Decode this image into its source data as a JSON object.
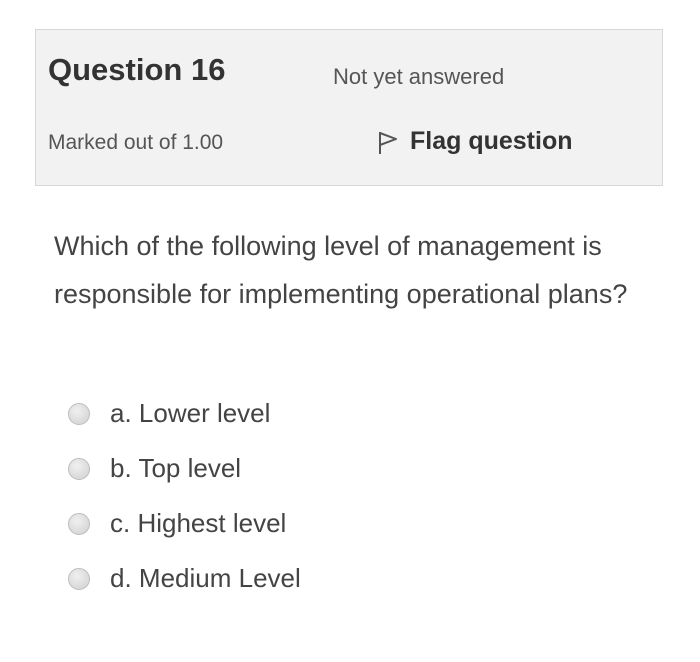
{
  "question": {
    "title": "Question 16",
    "status": "Not yet answered",
    "marks": "Marked out of 1.00",
    "flag_label": "Flag question",
    "text": "Which of the following level of management is responsible for implementing operational plans?",
    "flag_icon": "flag-icon"
  },
  "answers": [
    {
      "label": "a. Lower level"
    },
    {
      "label": "b. Top level"
    },
    {
      "label": "c. Highest level"
    },
    {
      "label": "d. Medium Level"
    }
  ],
  "colors": {
    "info_background": "#f2f2f2",
    "info_border": "#d7d7d7",
    "text": "#444444"
  }
}
